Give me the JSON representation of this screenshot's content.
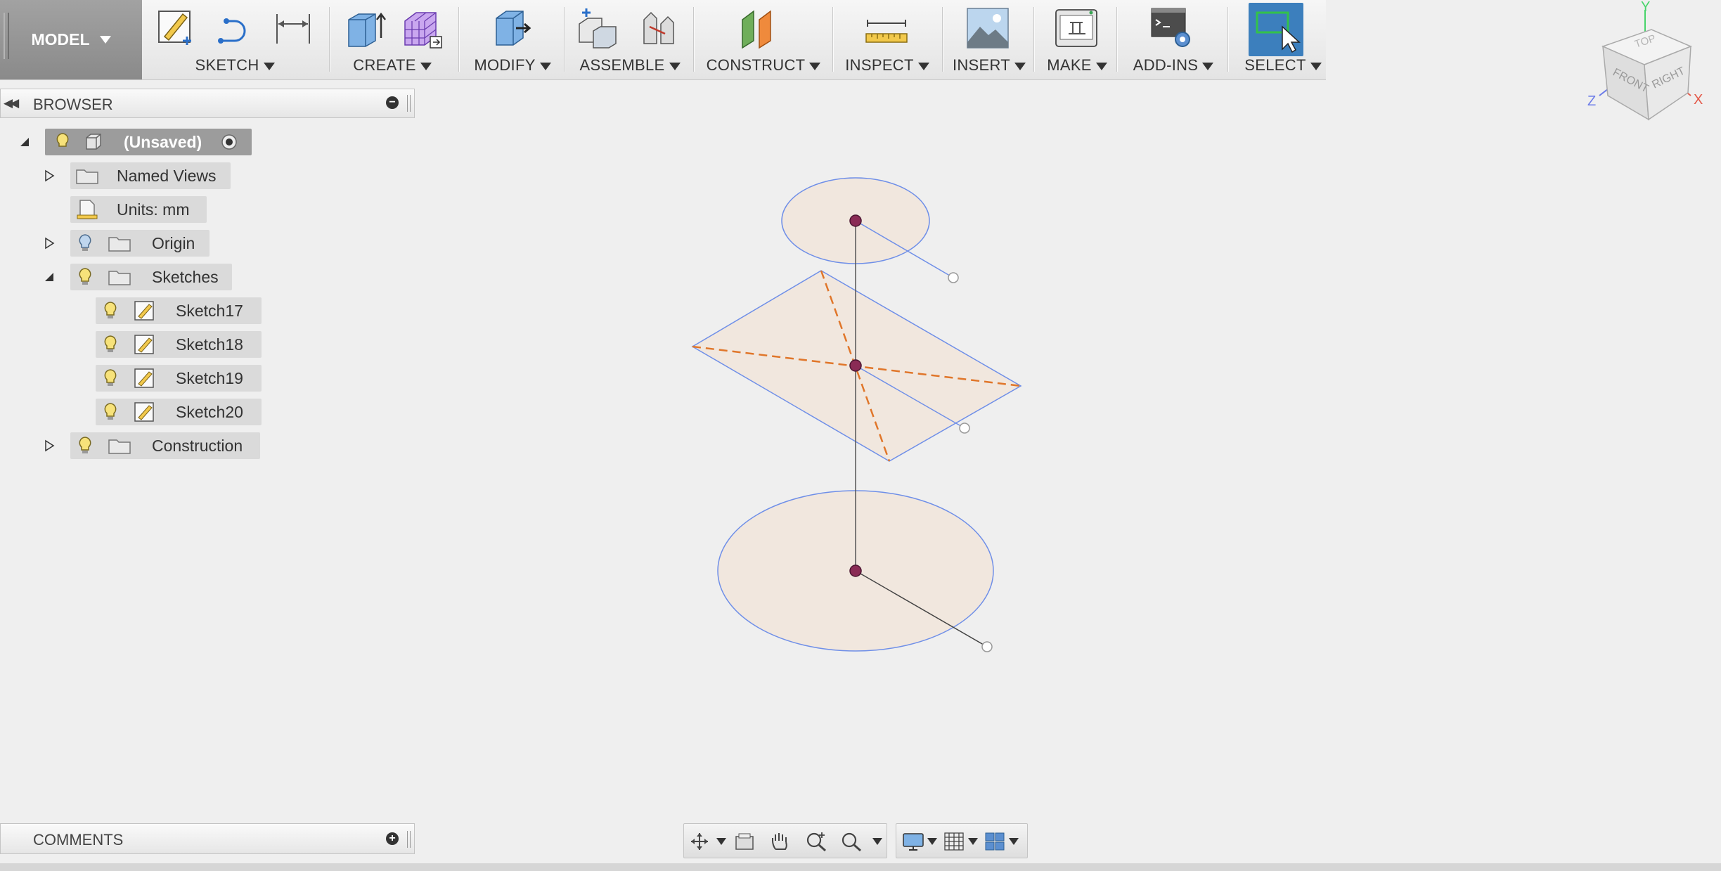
{
  "toolbar": {
    "model_label": "MODEL",
    "groups": [
      {
        "label": "SKETCH"
      },
      {
        "label": "CREATE"
      },
      {
        "label": "MODIFY"
      },
      {
        "label": "ASSEMBLE"
      },
      {
        "label": "CONSTRUCT"
      },
      {
        "label": "INSPECT"
      },
      {
        "label": "INSERT"
      },
      {
        "label": "MAKE"
      },
      {
        "label": "ADD-INS"
      },
      {
        "label": "SELECT"
      }
    ]
  },
  "browser": {
    "title": "BROWSER",
    "root": {
      "label": "(Unsaved)"
    },
    "items": [
      {
        "label": "Named Views"
      },
      {
        "label": "Units: mm"
      },
      {
        "label": "Origin"
      },
      {
        "label": "Sketches"
      },
      {
        "label": "Sketch17"
      },
      {
        "label": "Sketch18"
      },
      {
        "label": "Sketch19"
      },
      {
        "label": "Sketch20"
      },
      {
        "label": "Construction"
      }
    ]
  },
  "comments": {
    "title": "COMMENTS"
  },
  "viewcube": {
    "top": "TOP",
    "front": "FRONT",
    "right": "RIGHT",
    "axis_x": "X",
    "axis_y": "Y",
    "axis_z": "Z"
  },
  "colors": {
    "accent": "#3c7fbd",
    "sketch_line": "#6f8fe8",
    "construction_line": "#e0762a",
    "profile_fill": "#f1e7de",
    "point": "#8a2b55"
  }
}
